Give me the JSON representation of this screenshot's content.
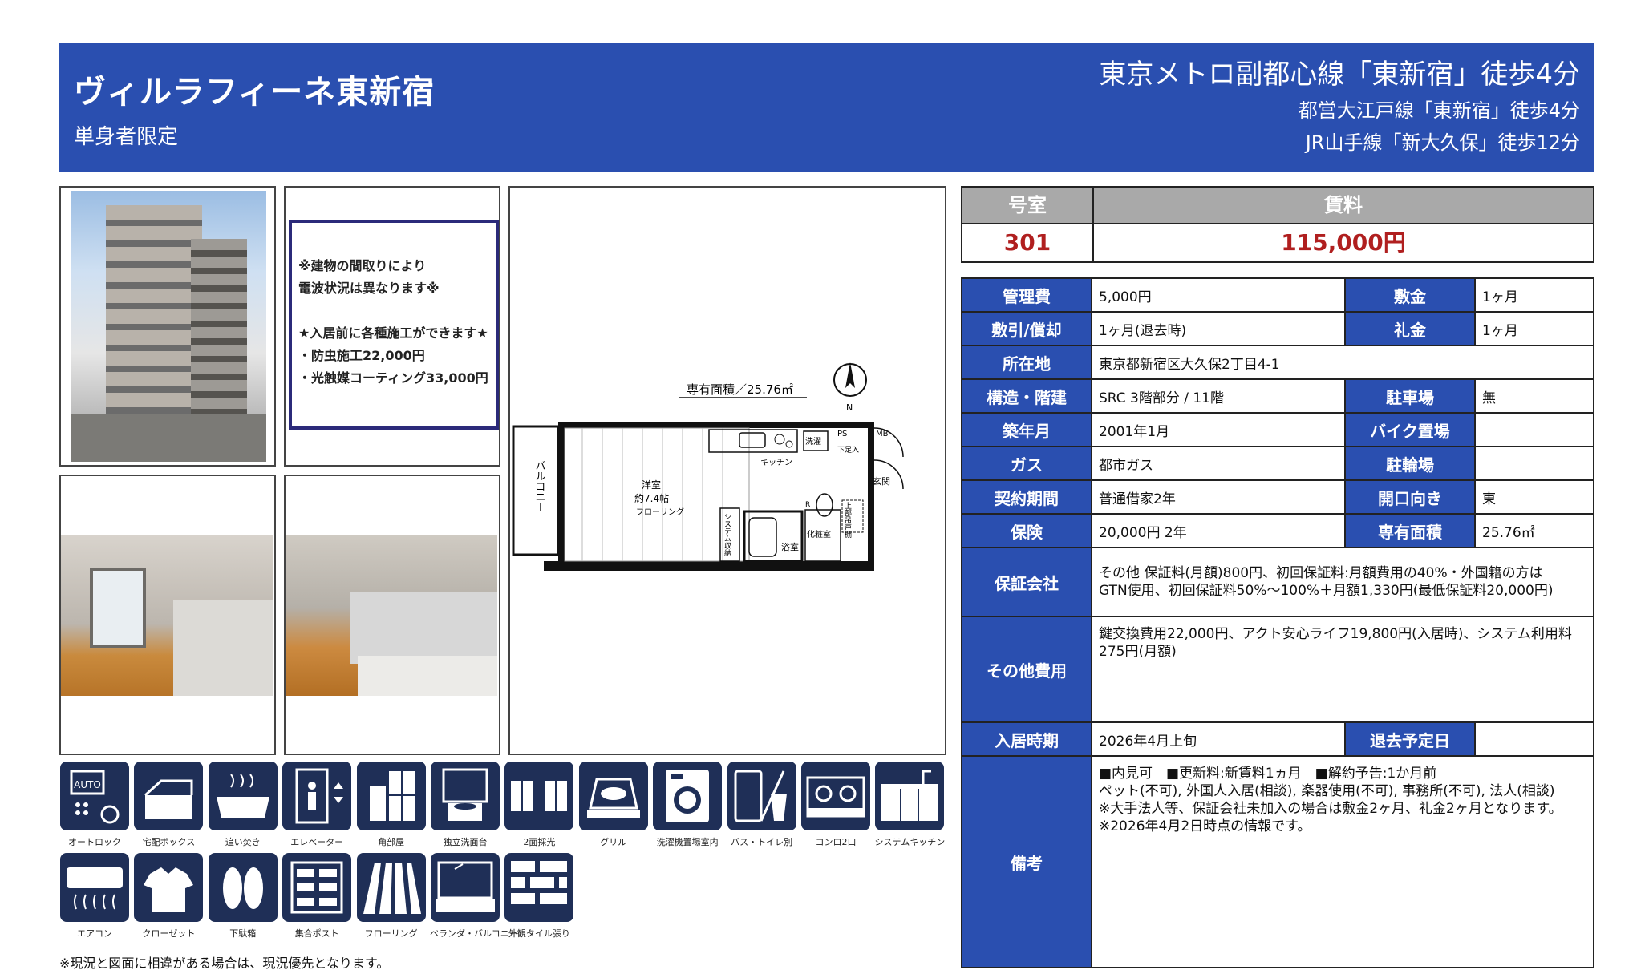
{
  "header": {
    "title": "ヴィルラフィーネ東新宿",
    "subtitle": "単身者限定",
    "access": [
      "東京メトロ副都心線「東新宿」徒歩4分",
      "都営大江戸線「東新宿」徒歩4分",
      "JR山手線「新大久保」徒歩12分"
    ]
  },
  "notice": {
    "lines": [
      "※建物の間取りにより",
      "電波状況は異なります※",
      "★入居前に各種施工ができます★",
      "・防虫施工22,000円",
      "・光触媒コーティング33,000円"
    ]
  },
  "floorplan": {
    "area_label": "専有面積／25.76㎡",
    "north": "N",
    "balcony": "バルコニー",
    "room": "洋室",
    "room_size": "約7.4帖",
    "flooring": "フローリング",
    "kitchen": "キッチン",
    "wash": "洗濯",
    "ps": "PS",
    "mb": "MB",
    "shoe": "下足入",
    "entrance": "玄関",
    "storage": "システム収納",
    "bath": "浴室",
    "toilet": "化粧室",
    "upper_storage": "上部吊戸棚",
    "r": "R"
  },
  "equipment": [
    {
      "icon": "auto-lock-icon",
      "label": "オートロック"
    },
    {
      "icon": "delivery-box-icon",
      "label": "宅配ボックス"
    },
    {
      "icon": "reheating-bath-icon",
      "label": "追い焚き"
    },
    {
      "icon": "elevator-icon",
      "label": "エレベーター"
    },
    {
      "icon": "corner-room-icon",
      "label": "角部屋"
    },
    {
      "icon": "vanity-icon",
      "label": "独立洗面台"
    },
    {
      "icon": "two-side-light-icon",
      "label": "2面採光"
    },
    {
      "icon": "grill-icon",
      "label": "グリル"
    },
    {
      "icon": "washer-icon",
      "label": "洗濯機置場室内"
    },
    {
      "icon": "separate-bath-toilet-icon",
      "label": "バス・トイレ別"
    },
    {
      "icon": "two-burner-stove-icon",
      "label": "コンロ2口"
    },
    {
      "icon": "system-kitchen-icon",
      "label": "システムキッチン"
    },
    {
      "icon": "air-conditioner-icon",
      "label": "エアコン"
    },
    {
      "icon": "closet-icon",
      "label": "クローゼット"
    },
    {
      "icon": "shoe-box-icon",
      "label": "下駄箱"
    },
    {
      "icon": "mailbox-icon",
      "label": "集合ポスト"
    },
    {
      "icon": "flooring-icon",
      "label": "フローリング"
    },
    {
      "icon": "balcony-icon",
      "label": "ベランダ・バルコニー"
    },
    {
      "icon": "tile-exterior-icon",
      "label": "外観タイル張り"
    }
  ],
  "footnote": "※現況と図面に相違がある場合は、現況優先となります。",
  "summary": {
    "room_label": "号室",
    "rent_label": "賃料",
    "room_value": "301",
    "rent_value": "115,000円"
  },
  "details": {
    "mgmt_label": "管理費",
    "mgmt_value": "5,000円",
    "deposit_label": "敷金",
    "deposit_value": "1ヶ月",
    "shikibiki_label": "敷引/償却",
    "shikibiki_value": "1ヶ月(退去時)",
    "keymoney_label": "礼金",
    "keymoney_value": "1ヶ月",
    "address_label": "所在地",
    "address_value": "東京都新宿区大久保2丁目4-1",
    "structure_label": "構造・階建",
    "structure_value": "SRC 3階部分 / 11階",
    "parking_label": "駐車場",
    "parking_value": "無",
    "built_label": "築年月",
    "built_value": "2001年1月",
    "bike_label": "バイク置場",
    "bike_value": "",
    "gas_label": "ガス",
    "gas_value": "都市ガス",
    "bicycle_label": "駐輪場",
    "bicycle_value": "",
    "contract_label": "契約期間",
    "contract_value": "普通借家2年",
    "facing_label": "開口向き",
    "facing_value": "東",
    "insurance_label": "保険",
    "insurance_value": "20,000円 2年",
    "area_label": "専有面積",
    "area_value": "25.76㎡",
    "guarantor_label": "保証会社",
    "guarantor_lines": [
      "その他 保証料(月額)800円、初回保証料:月額費用の40%・外国籍の方は",
      "GTN使用、初回保証料50%～100%＋月額1,330円(最低保証料20,000円)"
    ],
    "other_label": "その他費用",
    "other_lines": [
      "鍵交換費用22,000円、アクト安心ライフ19,800円(入居時)、システム利用料",
      "275円(月額)"
    ],
    "movein_label": "入居時期",
    "movein_value": "2026年4月上旬",
    "moveout_label": "退去予定日",
    "moveout_value": "",
    "remarks_label": "備考",
    "remarks_lines": [
      "■内見可　■更新料:新賃料1ヵ月　■解約予告:1か月前",
      "ペット(不可), 外国人入居(相談), 楽器使用(不可), 事務所(不可), 法人(相談)",
      "※大手法人等、保証会社未加入の場合は敷金2ヶ月、礼金2ヶ月となります。",
      "※2026年4月2日時点の情報です。"
    ]
  },
  "colors": {
    "header_bg": "#2a4fb0",
    "label_bg": "#2a4fb0",
    "summary_header_bg": "#a9a9a9",
    "price_red": "#b01f1f",
    "icon_bg": "#1f2f57"
  }
}
